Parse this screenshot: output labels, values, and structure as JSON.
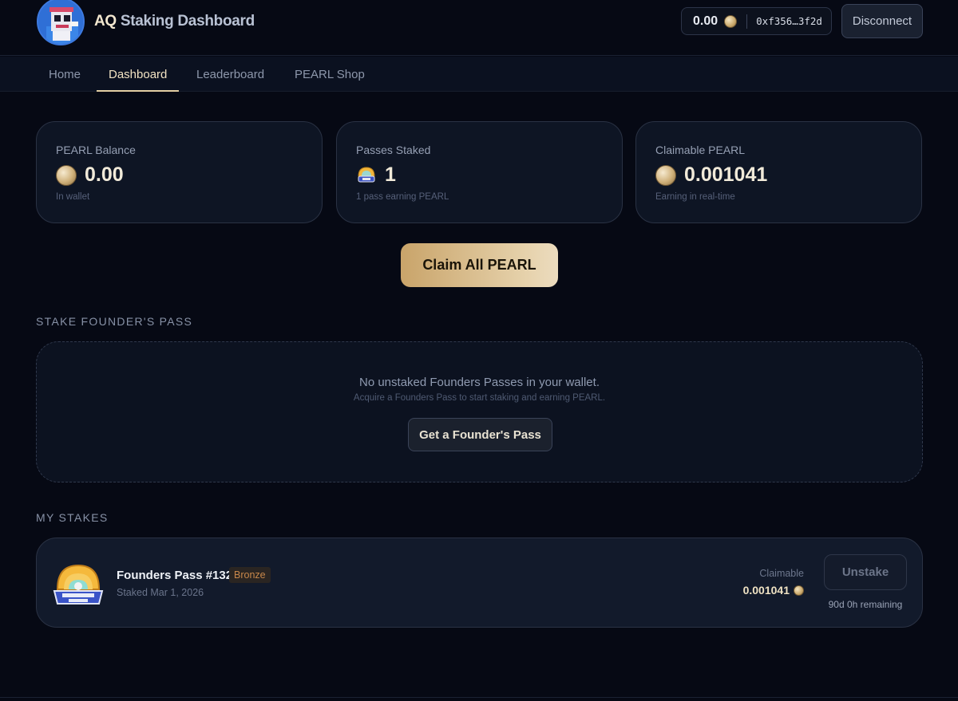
{
  "header": {
    "title_prefix": "AQ",
    "title_rest": " Staking Dashboard",
    "wallet_balance": "0.00",
    "wallet_address": "0xf356…3f2d",
    "disconnect_label": "Disconnect"
  },
  "nav": {
    "tabs": [
      {
        "label": "Home",
        "active": false
      },
      {
        "label": "Dashboard",
        "active": true
      },
      {
        "label": "Leaderboard",
        "active": false
      },
      {
        "label": "PEARL Shop",
        "active": false
      }
    ]
  },
  "stats": [
    {
      "label": "PEARL Balance",
      "value": "0.00",
      "sub": "In wallet",
      "icon": "pearl-icon"
    },
    {
      "label": "Passes Staked",
      "value": "1",
      "sub": "1 pass earning PEARL",
      "icon": "founders-pass-icon"
    },
    {
      "label": "Claimable PEARL",
      "value": "0.001041",
      "sub": "Earning in real-time",
      "icon": "pearl-icon"
    }
  ],
  "claim_all_label": "Claim All PEARL",
  "stake_section": {
    "title": "STAKE FOUNDER'S PASS",
    "empty_title": "No unstaked Founders Passes in your wallet.",
    "empty_sub": "Acquire a Founders Pass to start staking and earning PEARL.",
    "get_pass_label": "Get a Founder's Pass"
  },
  "my_stakes": {
    "title": "MY STAKES",
    "items": [
      {
        "name": "Founders Pass #132",
        "tier": "Bronze",
        "staked_date": "Staked Mar 1, 2026",
        "claimable_label": "Claimable",
        "claimable_amount": "0.001041",
        "unstake_label": "Unstake",
        "remaining": "90d 0h remaining"
      }
    ]
  },
  "colors": {
    "background": "#060914",
    "accent_gold": "#e3cfa3",
    "bronze": "#c7874a"
  }
}
